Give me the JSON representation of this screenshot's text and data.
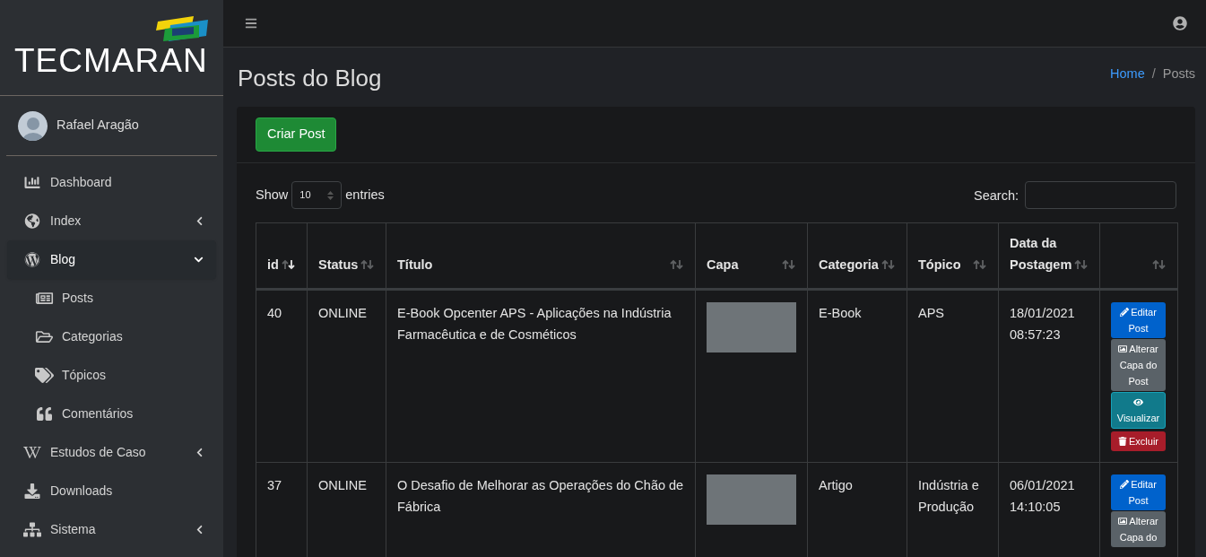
{
  "sidebar": {
    "logo": "TECMARAN",
    "user": "Rafael Aragão",
    "items": [
      {
        "label": "Dashboard",
        "selected": false,
        "expandable": false
      },
      {
        "label": "Index",
        "selected": false,
        "expandable": true,
        "expanded": false
      },
      {
        "label": "Blog",
        "selected": true,
        "expandable": true,
        "expanded": true,
        "children": [
          {
            "label": "Posts"
          },
          {
            "label": "Categorias"
          },
          {
            "label": "Tópicos"
          },
          {
            "label": "Comentários"
          }
        ]
      },
      {
        "label": "Estudos de Caso",
        "selected": false,
        "expandable": true,
        "expanded": false
      },
      {
        "label": "Downloads",
        "selected": false,
        "expandable": false
      },
      {
        "label": "Sistema",
        "selected": false,
        "expandable": true,
        "expanded": false
      }
    ]
  },
  "header": {
    "title": "Posts do Blog",
    "separator": "/",
    "breadcrumb": [
      {
        "label": "Home",
        "link": true
      },
      {
        "label": "Posts",
        "link": false
      }
    ]
  },
  "create_button": "Criar Post",
  "table_controls": {
    "show_label": "Show",
    "page_size": "10",
    "entries_label": "entries",
    "search_label": "Search:"
  },
  "table": {
    "columns": [
      {
        "label": "id",
        "sorted": true
      },
      {
        "label": "Status",
        "sorted": false
      },
      {
        "label": "Título",
        "sorted": false
      },
      {
        "label": "Capa",
        "sorted": false
      },
      {
        "label": "Categoria",
        "sorted": false
      },
      {
        "label": "Tópico",
        "sorted": false
      },
      {
        "label": "Data da Postagem",
        "sorted": false
      },
      {
        "sorted": false
      }
    ],
    "rows": [
      {
        "id": "40",
        "status": "ONLINE",
        "title": "E-Book Opcenter APS - Aplicações na Indústria Farmacêutica e de Cosméticos",
        "category": "E-Book",
        "topic": "APS",
        "date": "18/01/2021 08:57:23",
        "actions": [
          {
            "kind": "edit",
            "label": "Editar Post"
          },
          {
            "kind": "cover",
            "label": "Alterar Capa do Post"
          },
          {
            "kind": "view",
            "label": "Visualizar"
          },
          {
            "kind": "delete",
            "label": "Excluir"
          }
        ]
      },
      {
        "id": "37",
        "status": "ONLINE",
        "title": "O Desafio de Melhorar as Operações do Chão de Fábrica",
        "category": "Artigo",
        "topic": "Indústria e Produção",
        "date": "06/01/2021 14:10:05",
        "actions": [
          {
            "kind": "edit",
            "label": "Editar Post"
          },
          {
            "kind": "cover",
            "label": "Alterar Capa do"
          }
        ]
      }
    ]
  }
}
